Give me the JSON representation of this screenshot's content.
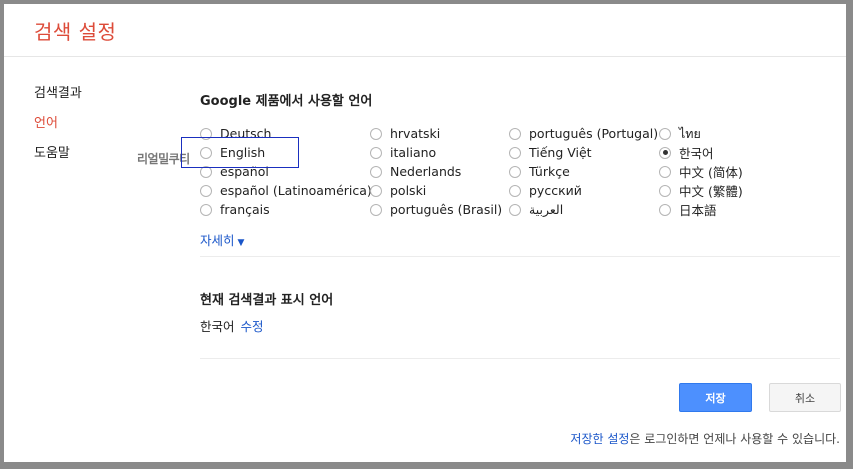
{
  "header": {
    "title": "검색 설정"
  },
  "sidebar": {
    "items": [
      {
        "label": "검색결과",
        "active": false
      },
      {
        "label": "언어",
        "active": true
      },
      {
        "label": "도움말",
        "active": false
      }
    ]
  },
  "overlay": {
    "text": "리얼밀쿠티"
  },
  "languages": {
    "title": "Google 제품에서 사용할 언어",
    "columns": [
      [
        "Deutsch",
        "English",
        "español",
        "español (Latinoamérica)",
        "français"
      ],
      [
        "hrvatski",
        "italiano",
        "Nederlands",
        "polski",
        "português (Brasil)"
      ],
      [
        "português (Portugal)",
        "Tiếng Việt",
        "Türkçe",
        "русский",
        "العربية"
      ],
      [
        "ไทย",
        "한국어",
        "中文 (简体)",
        "中文 (繁體)",
        "日本語"
      ]
    ],
    "selected": "한국어",
    "more_label": "자세히"
  },
  "current": {
    "title": "현재 검색결과 표시 언어",
    "value": "한국어",
    "edit_label": "수정"
  },
  "buttons": {
    "save": "저장",
    "cancel": "취소"
  },
  "footer": {
    "link": "저장한 설정",
    "text": "은 로그인하면 언제나 사용할 수 있습니다."
  },
  "colors": {
    "accent_red": "#dd4b39",
    "link_blue": "#1a56c9",
    "primary_button": "#4d90fe"
  }
}
